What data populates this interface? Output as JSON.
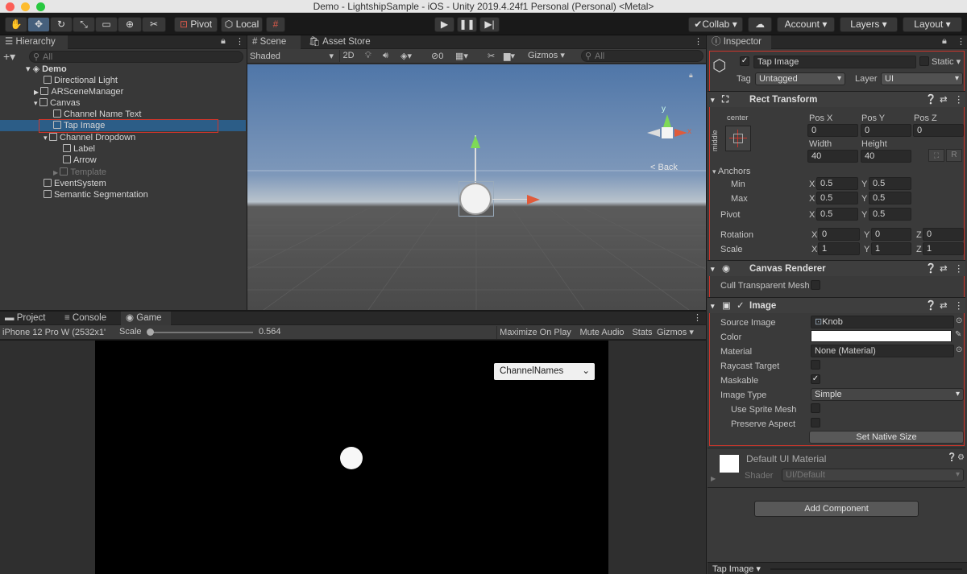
{
  "window_title": "Demo - LightshipSample - iOS - Unity 2019.4.24f1 Personal (Personal) <Metal>",
  "toolbar": {
    "pivot": "Pivot",
    "local": "Local",
    "collab": "Collab",
    "account": "Account",
    "layers": "Layers",
    "layout": "Layout"
  },
  "hierarchy": {
    "tab": "Hierarchy",
    "search_placeholder": "All",
    "scene": "Demo",
    "items": [
      {
        "label": "Directional Light"
      },
      {
        "label": "ARSceneManager"
      },
      {
        "label": "Canvas"
      },
      {
        "label": "Channel Name Text"
      },
      {
        "label": "Tap Image"
      },
      {
        "label": "Channel Dropdown"
      },
      {
        "label": "Label"
      },
      {
        "label": "Arrow"
      },
      {
        "label": "Template"
      },
      {
        "label": "EventSystem"
      },
      {
        "label": "Semantic Segmentation"
      }
    ]
  },
  "scene_view": {
    "tabs": [
      "Scene",
      "Asset Store"
    ],
    "shading": "Shaded",
    "mode_2d": "2D",
    "hidden_count": "0",
    "gizmos": "Gizmos",
    "search_placeholder": "All",
    "back_label": "< Back",
    "axis_y": "y",
    "axis_x": "x"
  },
  "bottom_tabs": [
    "Project",
    "Console",
    "Game"
  ],
  "game_view": {
    "device": "iPhone 12 Pro W (2532x1'",
    "scale_label": "Scale",
    "scale_value": "0.564",
    "scale_fraction": 0.0,
    "maximize": "Maximize On Play",
    "mute": "Mute Audio",
    "stats": "Stats",
    "gizmos": "Gizmos",
    "dropdown": "ChannelNames"
  },
  "inspector": {
    "tab": "Inspector",
    "object_name": "Tap Image",
    "static": "Static",
    "tag_label": "Tag",
    "tag_value": "Untagged",
    "layer_label": "Layer",
    "layer_value": "UI",
    "rect_transform": {
      "title": "Rect Transform",
      "anchor_h": "center",
      "anchor_v": "middle",
      "posx_label": "Pos X",
      "posx": "0",
      "posy_label": "Pos Y",
      "posy": "0",
      "posz_label": "Pos Z",
      "posz": "0",
      "width_label": "Width",
      "width": "40",
      "height_label": "Height",
      "height": "40",
      "reset_label": "R",
      "anchors_label": "Anchors",
      "min_label": "Min",
      "min_x": "0.5",
      "min_y": "0.5",
      "max_label": "Max",
      "max_x": "0.5",
      "max_y": "0.5",
      "pivot_label": "Pivot",
      "pivot_x": "0.5",
      "pivot_y": "0.5",
      "rotation_label": "Rotation",
      "rot_x": "0",
      "rot_y": "0",
      "rot_z": "0",
      "scale_label": "Scale",
      "scale_x": "1",
      "scale_y": "1",
      "scale_z": "1",
      "x": "X",
      "y": "Y",
      "z": "Z"
    },
    "canvas_renderer": {
      "title": "Canvas Renderer",
      "cull_label": "Cull Transparent Mesh"
    },
    "image": {
      "title": "Image",
      "source_label": "Source Image",
      "source_value": "Knob",
      "color_label": "Color",
      "color_value": "#ffffff",
      "material_label": "Material",
      "material_value": "None (Material)",
      "raycast_label": "Raycast Target",
      "maskable_label": "Maskable",
      "type_label": "Image Type",
      "type_value": "Simple",
      "sprite_mesh_label": "Use Sprite Mesh",
      "preserve_label": "Preserve Aspect",
      "native_size": "Set Native Size"
    },
    "material": {
      "name": "Default UI Material",
      "shader_label": "Shader",
      "shader_value": "UI/Default"
    },
    "add_component": "Add Component",
    "footer": "Tap Image"
  },
  "colors": {
    "selection": "#2c5d87",
    "highlight": "#d0352a",
    "sky_top": "#4f76a8",
    "ground": "#4a4a4a"
  }
}
